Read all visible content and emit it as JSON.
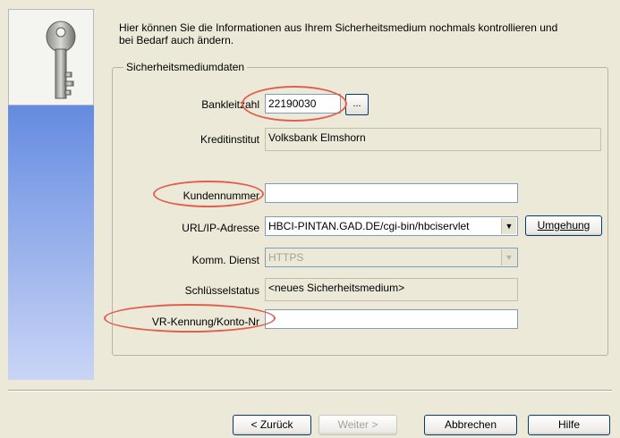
{
  "intro_text": "Hier können Sie die Informationen aus Ihrem Sicherheitsmedium nochmals kontrollieren und bei Bedarf auch ändern.",
  "group_title": "Sicherheitsmediumdaten",
  "fields": {
    "bankleitzahl": {
      "label": "Bankleitzahl",
      "value": "22190030",
      "browse_label": "..."
    },
    "kreditinstitut": {
      "label": "Kreditinstitut",
      "value": "Volksbank Elmshorn"
    },
    "kundennummer": {
      "label": "Kundennummer",
      "value": ""
    },
    "url": {
      "label": "URL/IP-Adresse",
      "value": "HBCI-PINTAN.GAD.DE/cgi-bin/hbciservlet",
      "button_label": "Umgehung"
    },
    "komm_dienst": {
      "label": "Komm. Dienst",
      "value": "HTTPS"
    },
    "schluesselstatus": {
      "label": "Schlüsselstatus",
      "value": "<neues Sicherheitsmedium>"
    },
    "vr_kennung": {
      "label": "VR-Kennung/Konto-Nr",
      "value": ""
    }
  },
  "buttons": {
    "back": "< Zurück",
    "next": "Weiter >",
    "cancel": "Abbrechen",
    "help": "Hilfe"
  },
  "colors": {
    "highlight_ellipse": "#e06050",
    "panel_gradient_top": "#3f6fd6",
    "panel_gradient_bottom": "#c9d5f5"
  },
  "icons": {
    "wizard_image": "key-icon"
  }
}
